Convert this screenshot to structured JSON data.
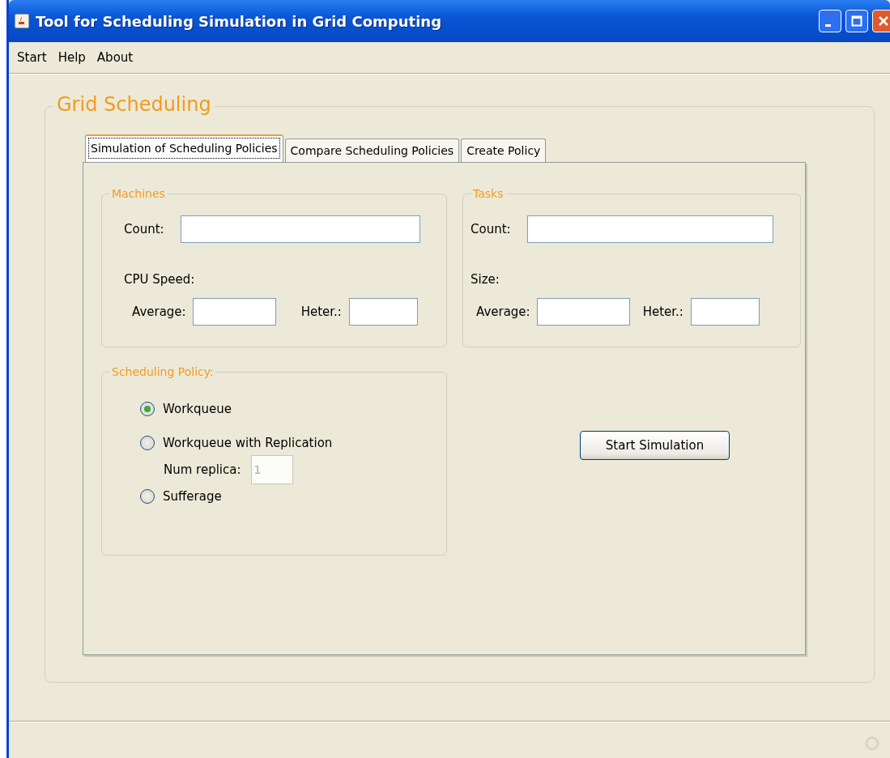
{
  "window": {
    "title": "Tool for Scheduling Simulation in Grid Computing"
  },
  "menu": [
    {
      "label": "Start"
    },
    {
      "label": "Help"
    },
    {
      "label": "About"
    }
  ],
  "frame": {
    "title": "Grid Scheduling"
  },
  "tabs": [
    {
      "label": "Simulation of Scheduling Policies",
      "selected": true
    },
    {
      "label": "Compare Scheduling Policies",
      "selected": false
    },
    {
      "label": "Create Policy",
      "selected": false
    }
  ],
  "machines": {
    "title": "Machines",
    "count_label": "Count:",
    "group_label": "CPU Speed:",
    "average_label": "Average:",
    "heter_label": "Heter.:"
  },
  "tasks": {
    "title": "Tasks",
    "count_label": "Count:",
    "group_label": "Size:",
    "average_label": "Average:",
    "heter_label": "Heter.:"
  },
  "policy": {
    "title": "Scheduling Policy:",
    "rows": [
      {
        "kind": "radio",
        "label": "Workqueue",
        "selected": true
      },
      {
        "kind": "radio",
        "label": "Workqueue with Replication",
        "selected": false
      },
      {
        "kind": "field",
        "label": "Num replica:",
        "value": "1",
        "disabled": true
      },
      {
        "kind": "radio",
        "label": "Sufferage",
        "selected": false
      }
    ]
  },
  "start_button": {
    "label": "Start Simulation"
  }
}
